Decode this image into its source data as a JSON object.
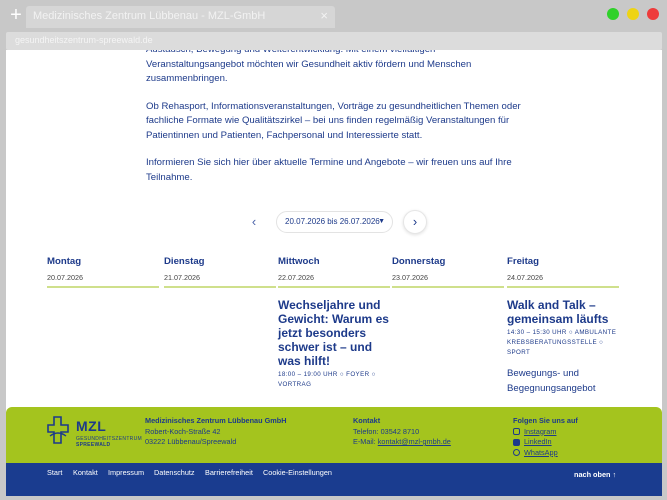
{
  "browser": {
    "tab_title": "Medizinisches Zentrum Lübbenau - MZL-GmbH",
    "close_glyph": "×",
    "new_tab_glyph": "+",
    "url": "gesundheitszentrum-spreewald.de"
  },
  "intro": {
    "line_cut": "Austausch, Bewegung und Weiterentwicklung. Mit einem vielfältigen Veranstaltungsangebot möchten wir Gesundheit aktiv fördern und Menschen zusammenbringen.",
    "p2": "Ob Rehasport, Informationsveranstaltungen, Vorträge zu gesundheitlichen Themen oder fachliche Formate wie Qualitätszirkel – bei uns finden regelmäßig Veranstaltungen für Patientinnen und Patienten, Fachpersonal und Interessierte statt.",
    "p3": "Informieren Sie sich hier über aktuelle Termine und Angebote – wir freuen uns auf Ihre Teilnahme."
  },
  "week": {
    "prev_glyph": "‹",
    "next_glyph": "›",
    "range": "20.07.2026 bis 26.07.2026",
    "caret": "▼"
  },
  "days": [
    {
      "name": "Montag",
      "date": "20.07.2026"
    },
    {
      "name": "Dienstag",
      "date": "21.07.2026"
    },
    {
      "name": "Mittwoch",
      "date": "22.07.2026"
    },
    {
      "name": "Donnerstag",
      "date": "23.07.2026"
    },
    {
      "name": "Freitag",
      "date": "24.07.2026"
    }
  ],
  "events": {
    "wed": {
      "title": "Wechseljahre und Gewicht: Warum es jetzt besonders schwer ist – und was hilft!",
      "meta": "18:00 – 19:00 UHR ○ FOYER ○ VORTRAG"
    },
    "fri": {
      "title": "Walk and Talk – gemeinsam läufts",
      "meta": "14:30 – 15:30 UHR ○ AMBULANTE KREBSBERATUNGSSTELLE ○ SPORT",
      "extra": "Bewegungs- und Begegnungsangebot"
    }
  },
  "footer": {
    "logo_word": "MZL",
    "logo_sub1": "GESUNDHEITSZENTRUM",
    "logo_sub2": "SPREEWALD",
    "company": "Medizinisches Zentrum Lübbenau GmbH",
    "street": "Robert-Koch-Straße 42",
    "city": "03222 Lübbenau/Spreewald",
    "contact_heading": "Kontakt",
    "phone": "Telefon: 03542 8710",
    "email_label": "E-Mail: ",
    "email": "kontakt@mzl-gmbh.de",
    "social_heading": "Folgen Sie uns auf",
    "social": [
      "Instagram",
      "LinkedIn",
      "WhatsApp"
    ],
    "links": [
      "Start",
      "Kontakt",
      "Impressum",
      "Datenschutz",
      "Barrierefreiheit",
      "Cookie-Einstellungen"
    ],
    "to_top": "nach oben ↑"
  },
  "colors": {
    "brand_blue": "#1d3a8a",
    "brand_green": "#a4c41e",
    "footer_bar": "#1a3c8f"
  }
}
